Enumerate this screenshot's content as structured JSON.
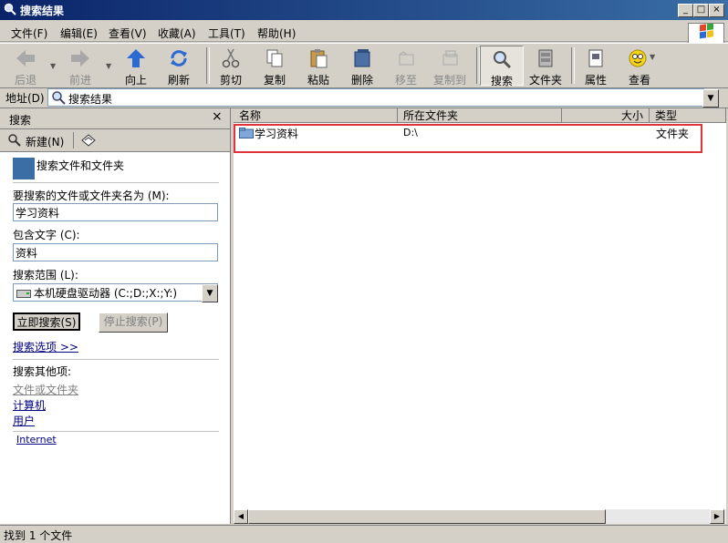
{
  "window": {
    "title": "搜索结果"
  },
  "menu": [
    "文件(F)",
    "编辑(E)",
    "查看(V)",
    "收藏(A)",
    "工具(T)",
    "帮助(H)"
  ],
  "toolbar": {
    "back": "后退",
    "forward": "前进",
    "up": "向上",
    "refresh": "刷新",
    "cut": "剪切",
    "copy": "复制",
    "paste": "粘贴",
    "delete": "删除",
    "move_to": "移至",
    "copy_to": "复制到",
    "search": "搜索",
    "folders": "文件夹",
    "properties": "属性",
    "view": "查看"
  },
  "address": {
    "label": "地址(D)",
    "value": "搜索结果"
  },
  "search_pane": {
    "title": "搜索",
    "new_label": "新建(N)",
    "heading": "搜索文件和文件夹",
    "name_label": "要搜索的文件或文件夹名为 (M):",
    "name_value": "学习资料",
    "text_label": "包含文字 (C):",
    "text_value": "资料",
    "scope_label": "搜索范围 (L):",
    "scope_value": "本机硬盘驱动器 (C:;D:;X:;Y:)",
    "search_now": "立即搜索(S)",
    "stop_search": "停止搜索(P)",
    "options_link": "搜索选项 >>",
    "other_label": "搜索其他项:",
    "other_files": "文件或文件夹",
    "other_computer": "计算机",
    "other_users": "用户",
    "other_internet": "Internet"
  },
  "list": {
    "columns": {
      "name": "名称",
      "folder": "所在文件夹",
      "size": "大小",
      "type": "类型"
    },
    "rows": [
      {
        "name": "学习资料",
        "folder": "D:\\",
        "size": "",
        "type": "文件夹"
      }
    ]
  },
  "status": {
    "text": "找到 1 个文件"
  },
  "colors": {
    "title_bar": "#0a246a",
    "highlight_border": "#e0333a",
    "link": "#000080"
  }
}
